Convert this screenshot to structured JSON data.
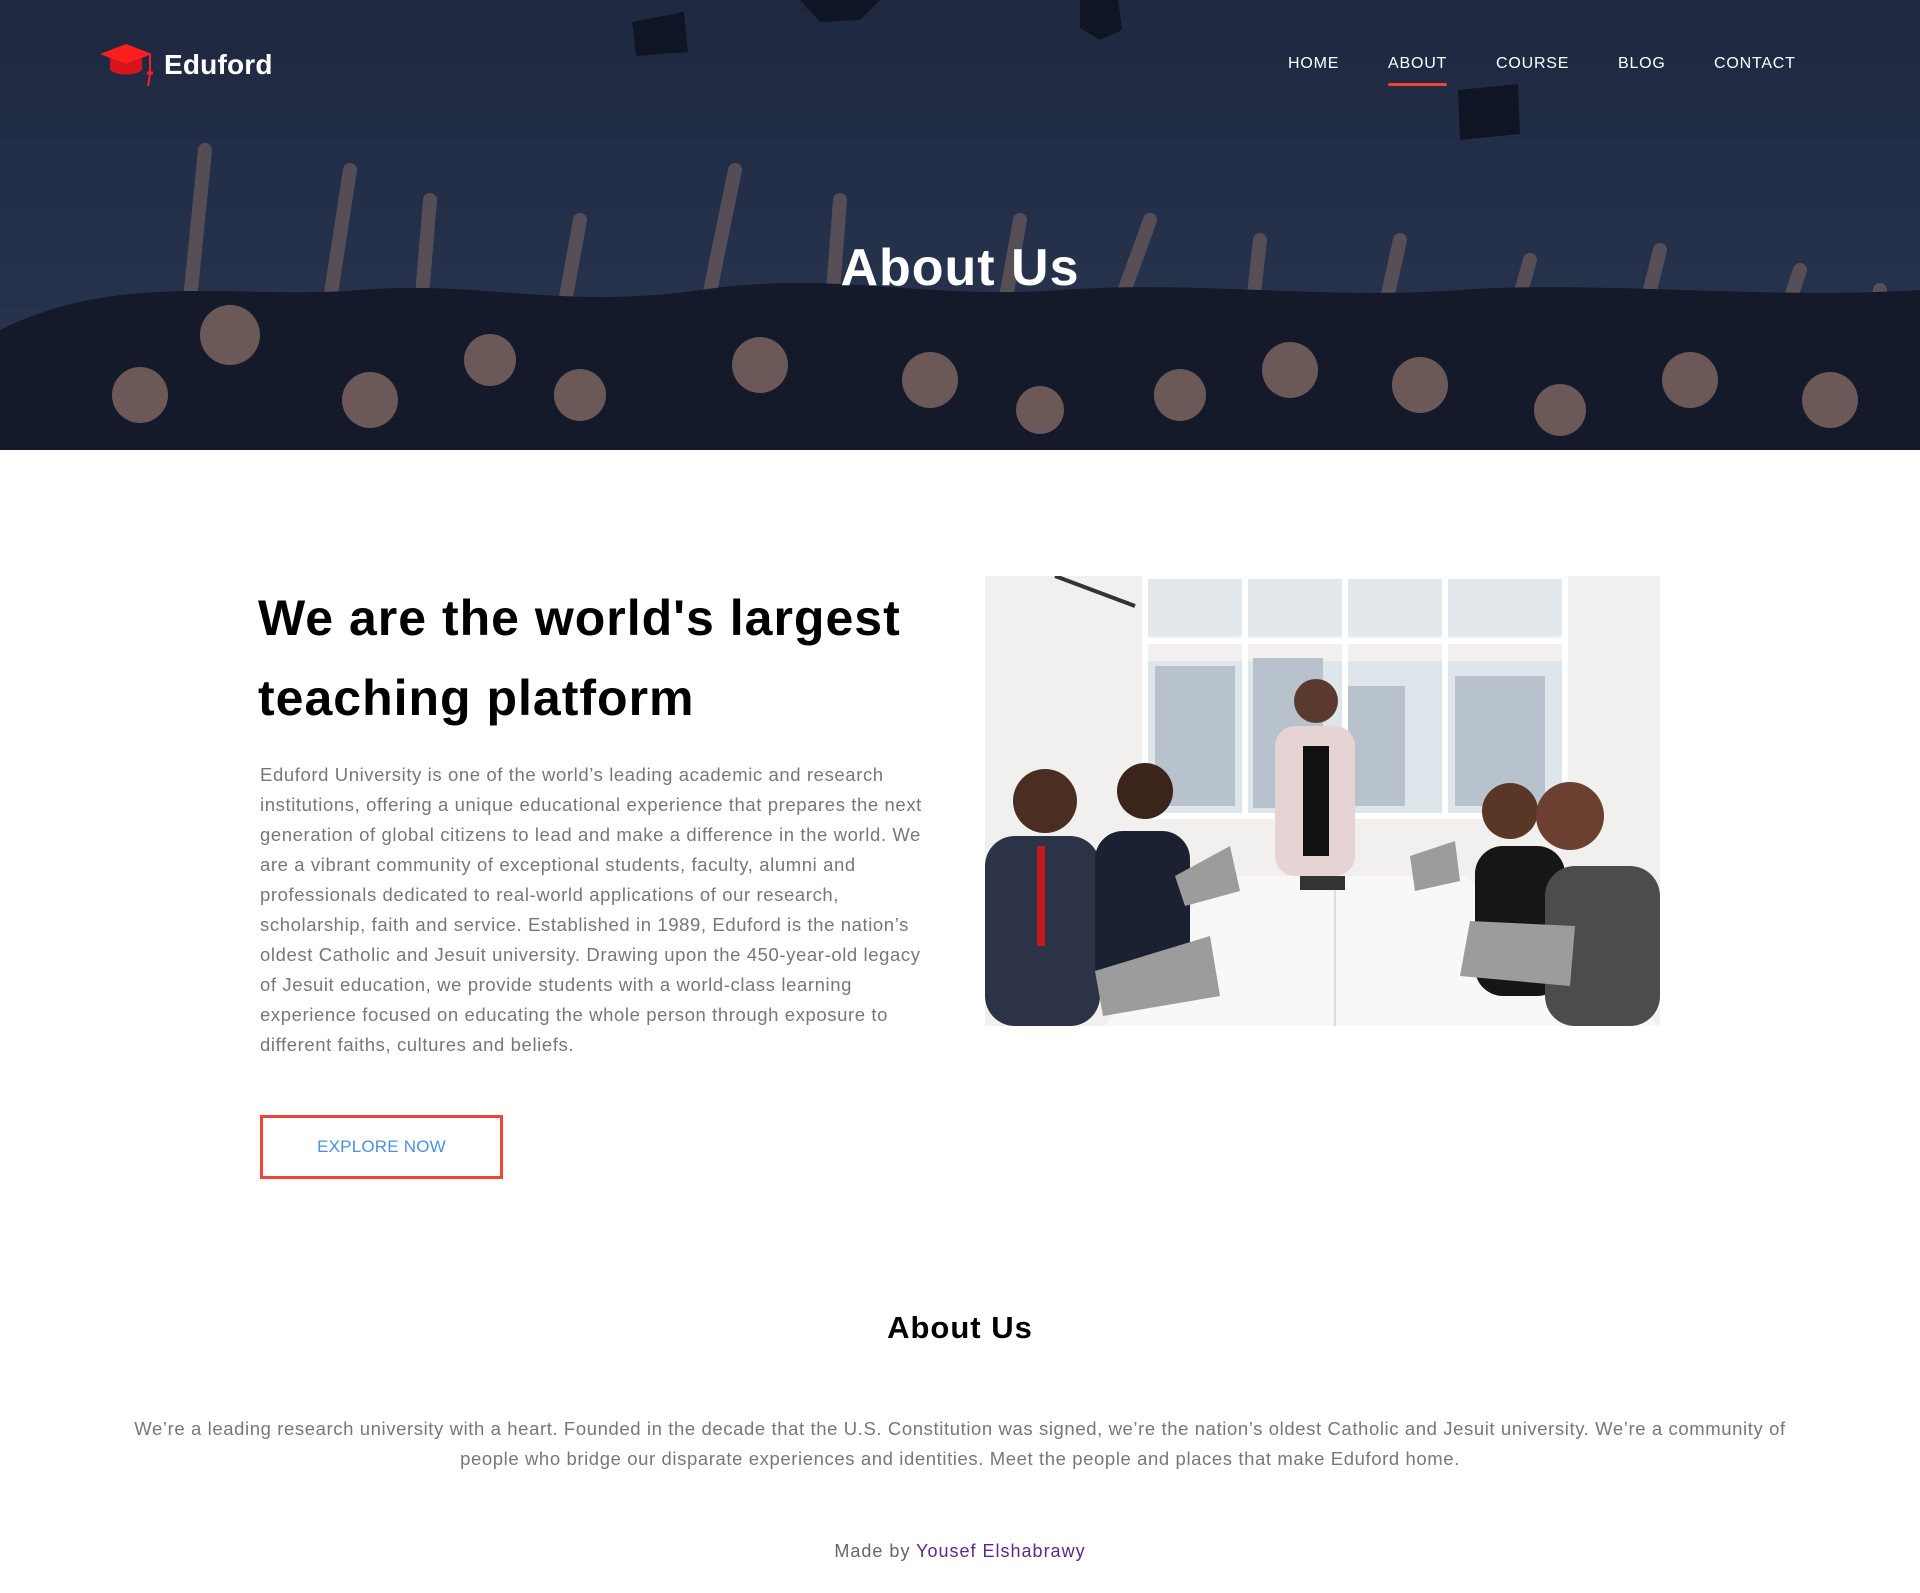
{
  "brand": {
    "name": "Eduford",
    "accent_color": "#f44336",
    "logo_icon": "graduation-cap-icon"
  },
  "nav": {
    "items": [
      {
        "label": "HOME"
      },
      {
        "label": "ABOUT"
      },
      {
        "label": "COURSE"
      },
      {
        "label": "BLOG"
      },
      {
        "label": "CONTACT"
      }
    ],
    "active": "ABOUT"
  },
  "hero": {
    "title": "About Us"
  },
  "about": {
    "heading": "We are the world's largest teaching platform",
    "paragraph": "Eduford University is one of the world’s leading academic and research institutions, offering a unique educational experience that prepares the next generation of global citizens to lead and make a difference in the world. We are a vibrant community of exceptional students, faculty, alumni and professionals dedicated to real-world applications of our research, scholarship, faith and service. Established in 1989, Eduford is the nation’s oldest Catholic and Jesuit university. Drawing upon the 450-year-old legacy of Jesuit education, we provide students with a world-class learning experience focused on educating the whole person through exposure to different faiths, cultures and beliefs.",
    "button_label": "EXPLORE NOW"
  },
  "section2": {
    "title": "About Us",
    "paragraph": "We’re a leading research university with a heart. Founded in the decade that the U.S. Constitution was signed, we’re the nation’s oldest Catholic and Jesuit university. We’re a community of people who bridge our disparate experiences and identities. Meet the people and places that make Eduford home."
  },
  "footer": {
    "prefix": "Made by",
    "author": "Yousef Elshabrawy"
  }
}
